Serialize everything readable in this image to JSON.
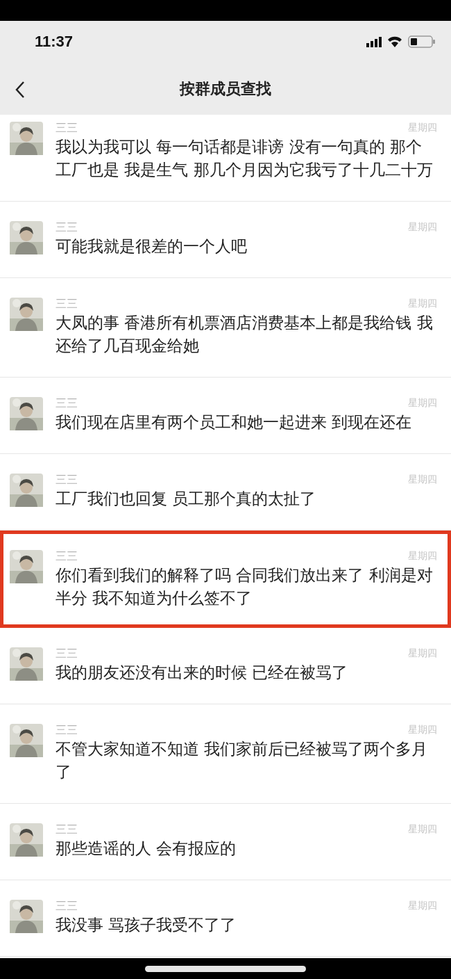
{
  "status_bar": {
    "time": "11:37"
  },
  "nav": {
    "title": "按群成员查找"
  },
  "messages": [
    {
      "sender": "三三",
      "time": "星期四",
      "text": "我以为我可以 每一句话都是诽谤 没有一句真的 那个工厂也是 我是生气 那几个月因为它我亏了十几二十万",
      "highlighted": false
    },
    {
      "sender": "三三",
      "time": "星期四",
      "text": "可能我就是很差的一个人吧",
      "highlighted": false
    },
    {
      "sender": "三三",
      "time": "星期四",
      "text": "大凤的事 香港所有机票酒店消费基本上都是我给钱 我还给了几百现金给她",
      "highlighted": false
    },
    {
      "sender": "三三",
      "time": "星期四",
      "text": "我们现在店里有两个员工和她一起进来 到现在还在",
      "highlighted": false
    },
    {
      "sender": "三三",
      "time": "星期四",
      "text": "工厂我们也回复 员工那个真的太扯了",
      "highlighted": false
    },
    {
      "sender": "三三",
      "time": "星期四",
      "text": "你们看到我们的解释了吗 合同我们放出来了 利润是对半分 我不知道为什么签不了",
      "highlighted": true
    },
    {
      "sender": "三三",
      "time": "星期四",
      "text": "我的朋友还没有出来的时候 已经在被骂了",
      "highlighted": false
    },
    {
      "sender": "三三",
      "time": "星期四",
      "text": "不管大家知道不知道 我们家前后已经被骂了两个多月了",
      "highlighted": false
    },
    {
      "sender": "三三",
      "time": "星期四",
      "text": "那些造谣的人 会有报应的",
      "highlighted": false
    },
    {
      "sender": "三三",
      "time": "星期四",
      "text": "我没事 骂孩子我受不了了",
      "highlighted": false
    }
  ]
}
